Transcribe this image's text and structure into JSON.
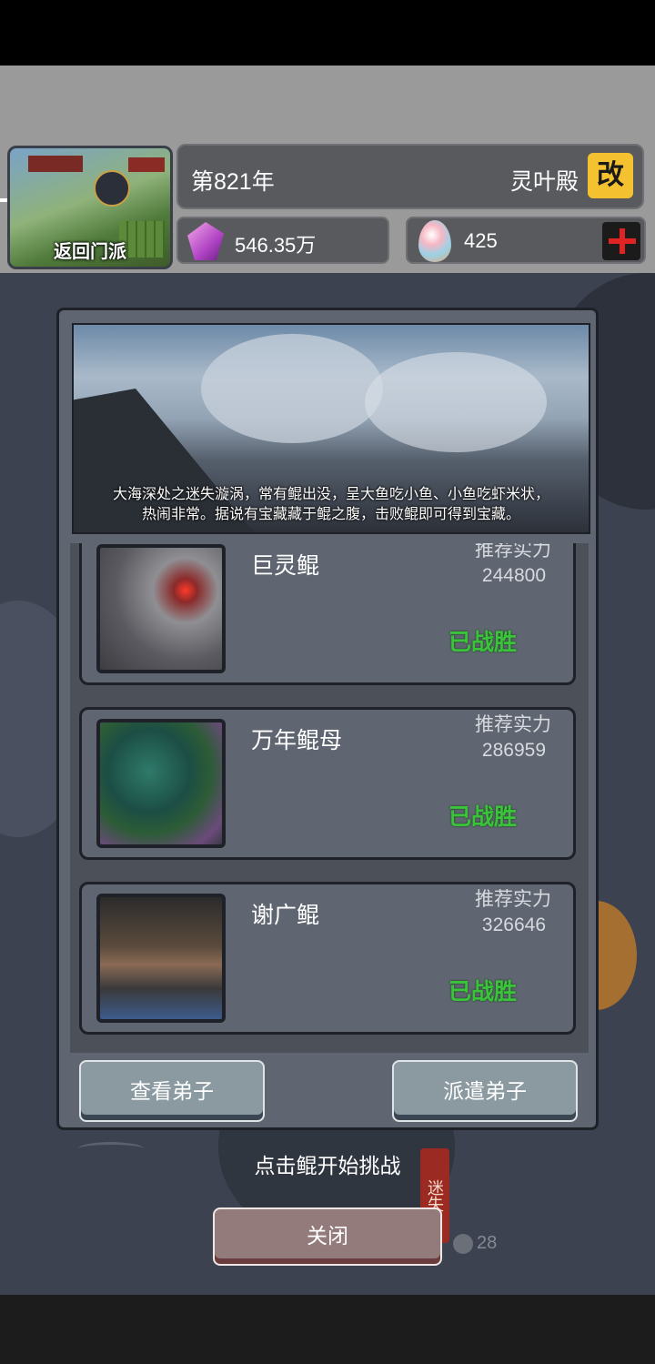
{
  "header": {
    "return_label": "返回门派",
    "year": "第821年",
    "sect_name": "灵叶殿",
    "edit_label": "改",
    "crystals": "546.35万",
    "eggs": "425"
  },
  "stage": {
    "description_line1": "大海深处之迷失漩涡，常有鲲出没，呈大鱼吃小鱼、小鱼吃虾米状，",
    "description_line2": "热闹非常。据说有宝藏藏于鲲之腹，击败鲲即可得到宝藏。"
  },
  "enemies": [
    {
      "name": "巨灵鲲",
      "rec_label": "推荐实力",
      "rec_value": "244800",
      "status": "已战胜"
    },
    {
      "name": "万年鲲母",
      "rec_label": "推荐实力",
      "rec_value": "286959",
      "status": "已战胜"
    },
    {
      "name": "谢广鲲",
      "rec_label": "推荐实力",
      "rec_value": "326646",
      "status": "已战胜"
    }
  ],
  "buttons": {
    "view_disciples": "查看弟子",
    "dispatch_disciples": "派遣弟子",
    "close": "关闭"
  },
  "hint": "点击鲲开始挑战",
  "background": {
    "tag_text": "迷失",
    "count": "28"
  },
  "colors": {
    "status_green": "#3bc43b",
    "edit_yellow": "#f4c230",
    "plus_red": "#e02424"
  }
}
